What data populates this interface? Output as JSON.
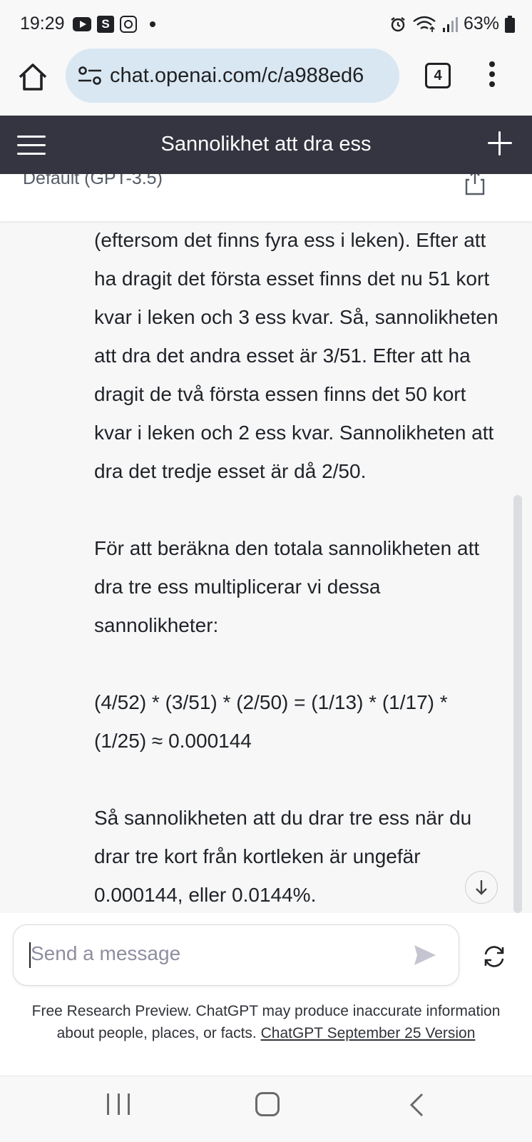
{
  "status_bar": {
    "time": "19:29",
    "s_badge": "S",
    "battery": "63%",
    "icons": [
      "youtube-icon",
      "s-app-icon",
      "instagram-icon",
      "notification-dot-icon",
      "alarm-icon",
      "wifi-icon",
      "signal-icon",
      "battery-icon"
    ]
  },
  "browser": {
    "url": "chat.openai.com/c/a988ed6",
    "tab_count": "4"
  },
  "app_header": {
    "title": "Sannolikhet att dra ess"
  },
  "model_row": {
    "model_name": "Default (GPT-3.5)"
  },
  "conversation": {
    "paragraphs": [
      "(eftersom det finns fyra ess i leken). Efter att ha dragit det första esset finns det nu 51 kort kvar i leken och 3 ess kvar. Så, sannolikheten att dra det andra esset är 3/51. Efter att ha dragit de två första essen finns det 50 kort kvar i leken och 2 ess kvar. Sannolikheten att dra det tredje esset är då 2/50.",
      "För att beräkna den totala sannolikheten att dra tre ess multiplicerar vi dessa sannolikheter:",
      "(4/52) * (3/51) * (2/50) = (1/13) * (1/17) * (1/25) ≈ 0.000144",
      "Så sannolikheten att du drar tre ess när du drar tre kort från kortleken är ungefär 0.000144, eller 0.0144%."
    ]
  },
  "composer": {
    "placeholder": "Send a message",
    "disclaimer_text": "Free Research Preview. ChatGPT may produce inaccurate information about people, places, or facts. ",
    "disclaimer_link": "ChatGPT September 25 Version"
  },
  "colors": {
    "header_bg": "#343541",
    "chat_bg": "#f7f7f8",
    "url_pill": "#d9e7f2"
  }
}
